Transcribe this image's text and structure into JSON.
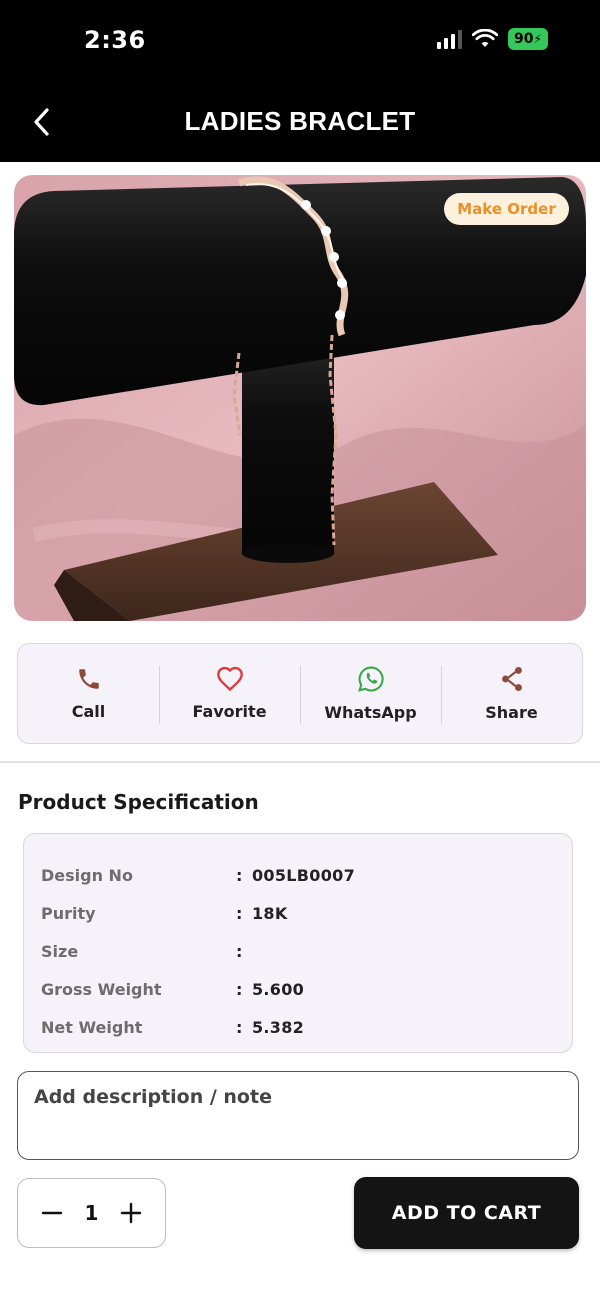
{
  "status_bar": {
    "time": "2:36",
    "battery": "90",
    "icons": [
      "cellular-signal-icon",
      "wifi-icon",
      "battery-charging-icon"
    ]
  },
  "header": {
    "title": "LADIES BRACLET",
    "back_icon": "chevron-left-icon"
  },
  "product": {
    "image_description_icon": "product-photo",
    "badge_label": "Make Order"
  },
  "actions": [
    {
      "label": "Call",
      "icon": "phone-icon",
      "color": "#8b4a3a"
    },
    {
      "label": "Favorite",
      "icon": "heart-icon",
      "color": "#e0363c"
    },
    {
      "label": "WhatsApp",
      "icon": "whatsapp-icon",
      "color": "#3aa84a"
    },
    {
      "label": "Share",
      "icon": "share-icon",
      "color": "#8b4a3a"
    }
  ],
  "spec": {
    "title": "Product Specification",
    "rows": [
      {
        "label": "Design No",
        "value": "005LB0007"
      },
      {
        "label": "Purity",
        "value": "18K"
      },
      {
        "label": "Size",
        "value": ""
      },
      {
        "label": "Gross Weight",
        "value": "5.600"
      },
      {
        "label": "Net Weight",
        "value": "5.382"
      }
    ],
    "separator": ":"
  },
  "note": {
    "placeholder": "Add description / note",
    "value": ""
  },
  "cart": {
    "quantity": "1",
    "add_label": "ADD TO CART"
  },
  "colors": {
    "accent_badge_text": "#e8902a",
    "accent_badge_bg": "#fdf1dd",
    "card_bg": "#f6f2fa",
    "primary_button": "#141414"
  }
}
